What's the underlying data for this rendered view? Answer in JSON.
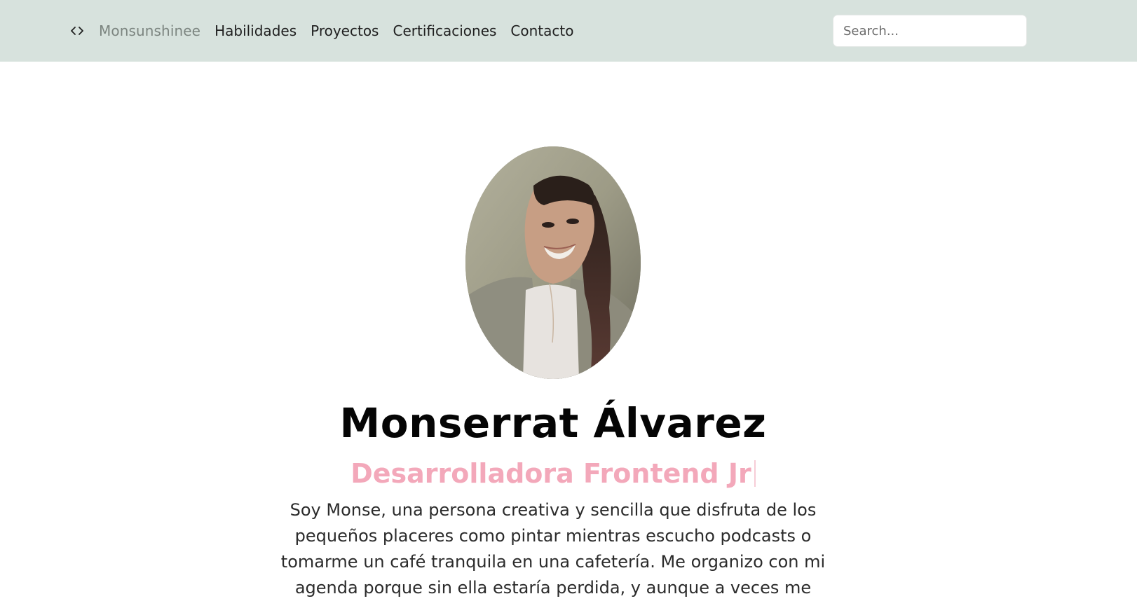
{
  "navbar": {
    "icon": "code-icon",
    "brand": "Monsunshinee",
    "links": [
      "Habilidades",
      "Proyectos",
      "Certificaciones",
      "Contacto"
    ],
    "search_placeholder": "Search..."
  },
  "hero": {
    "avatar": "profile-photo",
    "name": "Monserrat Álvarez",
    "role": "Desarrolladora Frontend Jr",
    "bio": "Soy Monse, una persona creativa y sencilla que disfruta de los pequeños placeres como pintar mientras escucho podcasts o tomarme un café tranquila en una cafetería. Me organizo con mi agenda porque sin ella estaría perdida, y aunque a veces me"
  },
  "colors": {
    "navbar_bg": "#d7e2dd",
    "accent_pink": "#f3a8ba",
    "brand_gray": "#7c8580"
  }
}
